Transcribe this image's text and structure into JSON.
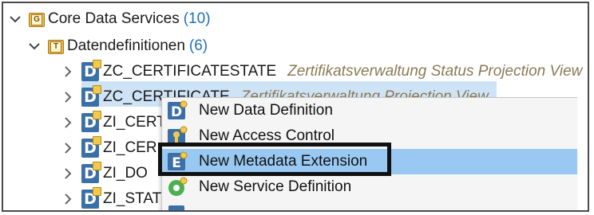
{
  "tree": {
    "core_data_services": {
      "label": "Core Data Services",
      "count": "(10)",
      "folder_letter": "G"
    },
    "datendefinitionen": {
      "label": "Datendefinitionen",
      "count": "(6)",
      "folder_letter": "T"
    },
    "entries": [
      {
        "name": "ZC_CERTIFICATESTATE",
        "description": "Zertifikatsverwaltung Status Projection View"
      },
      {
        "name": "ZC_CERTIFICATE",
        "description": "Zertifikatsverwaltung Projection View"
      },
      {
        "name": "ZI_CERT",
        "description": ""
      },
      {
        "name": "ZI_CER",
        "description": ""
      },
      {
        "name": "ZI_DO",
        "description": ""
      },
      {
        "name": "ZI_STAT",
        "description": ""
      }
    ]
  },
  "context_menu": {
    "items": [
      {
        "label": "New Data Definition",
        "icon": "data-definition-icon"
      },
      {
        "label": "New Access Control",
        "icon": "access-control-icon"
      },
      {
        "label": "New Metadata Extension",
        "icon": "metadata-extension-icon",
        "highlighted": true
      },
      {
        "label": "New Service Definition",
        "icon": "service-definition-icon"
      }
    ]
  },
  "colors": {
    "selection": "#cfe3f7",
    "menu_highlight": "#99c9f2",
    "count": "#1f6fbf",
    "description": "#8a7a55"
  }
}
